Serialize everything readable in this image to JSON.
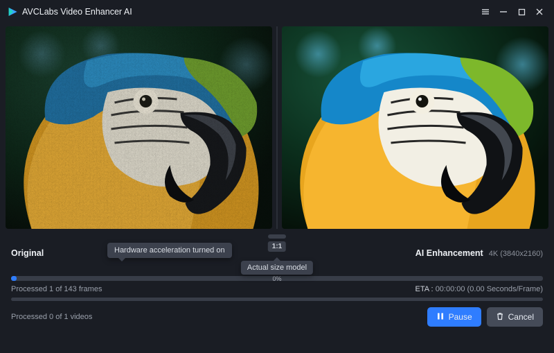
{
  "app": {
    "title": "AVCLabs Video Enhancer AI"
  },
  "labels": {
    "original": "Original",
    "enhancement": "AI Enhancement",
    "resolution": "4K (3840x2160)",
    "ratio": "1:1",
    "hw_tooltip": "Hardware acceleration turned on",
    "size_tooltip": "Actual size model"
  },
  "progress": {
    "frames_percent_text": "0%",
    "frames_fill_width": "1.1%",
    "frames_text": "Processed 1 of 143 frames",
    "eta_label": "ETA :",
    "eta_value": "00:00:00 (0.00 Seconds/Frame)",
    "videos_text": "Processed 0 of 1 videos",
    "videos_fill_width": "0%"
  },
  "buttons": {
    "pause": "Pause",
    "cancel": "Cancel"
  }
}
